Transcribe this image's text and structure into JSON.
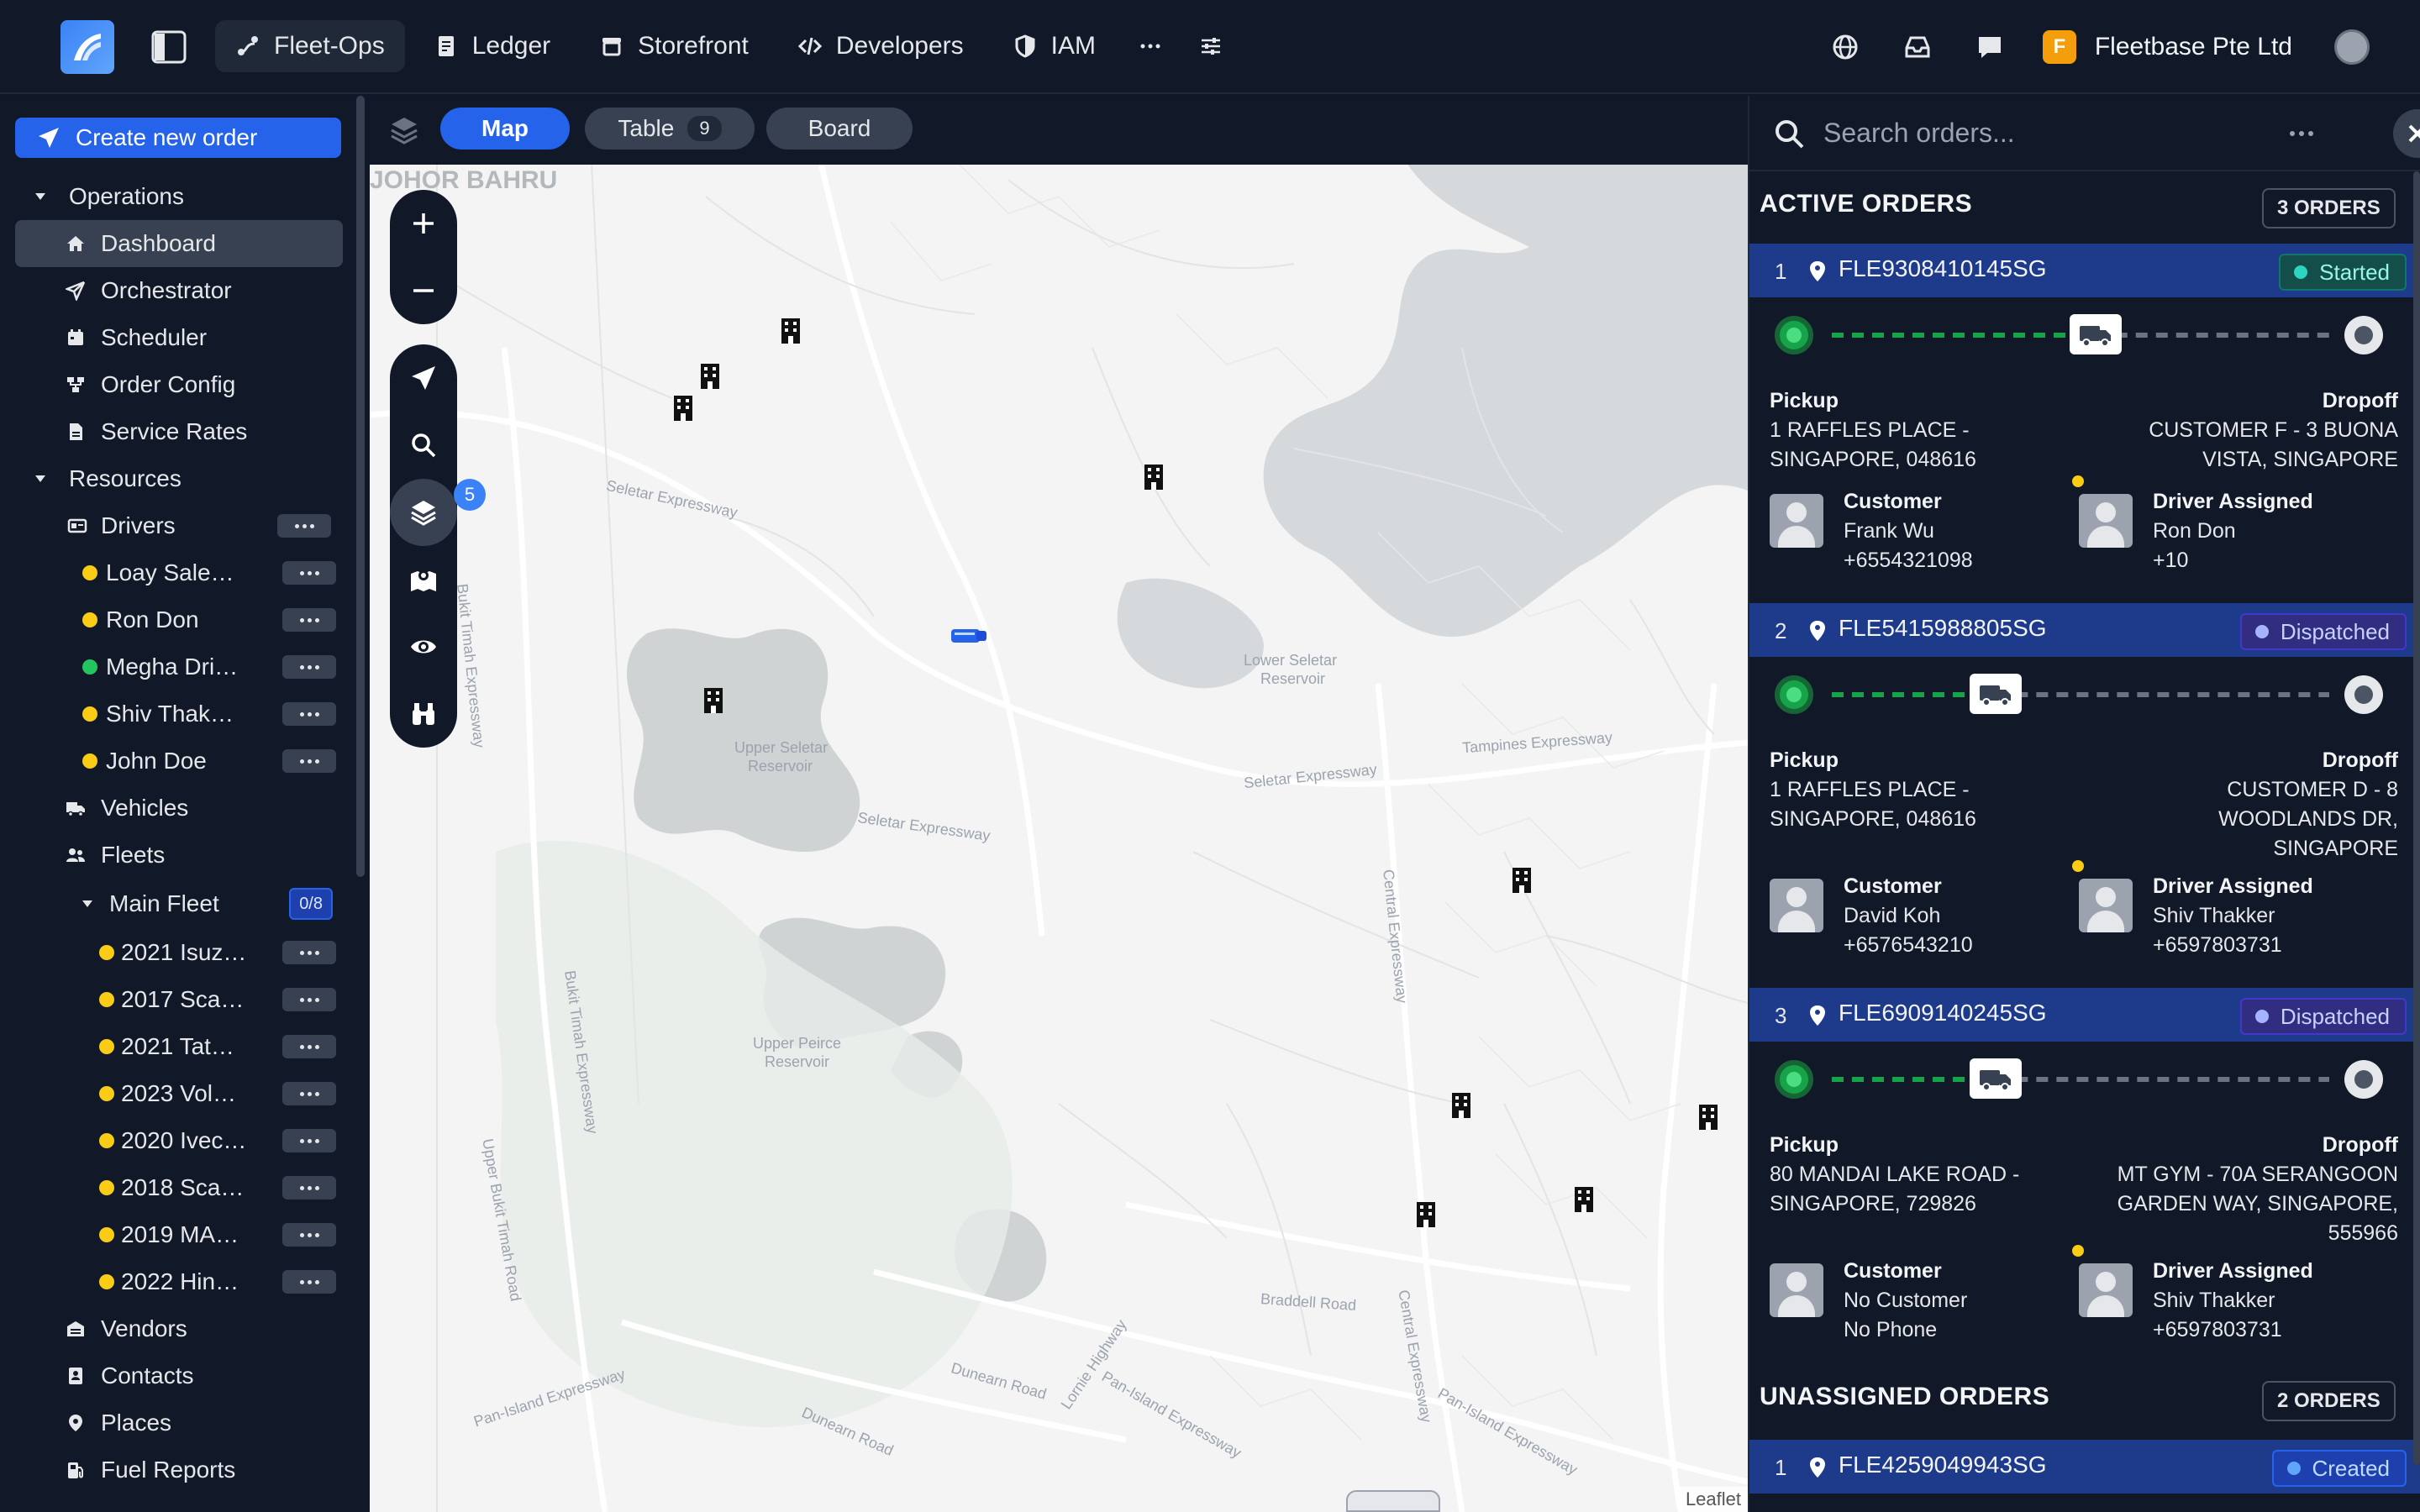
{
  "nav": {
    "items": [
      {
        "label": "Fleet-Ops",
        "icon": "route-icon"
      },
      {
        "label": "Ledger",
        "icon": "receipt-icon"
      },
      {
        "label": "Storefront",
        "icon": "store-icon"
      },
      {
        "label": "Developers",
        "icon": "code-icon"
      },
      {
        "label": "IAM",
        "icon": "shield-icon"
      }
    ],
    "org_initial": "F",
    "org_name": "Fleetbase Pte Ltd"
  },
  "sidebar": {
    "create_label": "Create new order",
    "operations": "Operations",
    "dashboard": "Dashboard",
    "orchestrator": "Orchestrator",
    "scheduler": "Scheduler",
    "order_config": "Order Config",
    "service_rates": "Service Rates",
    "resources": "Resources",
    "drivers": "Drivers",
    "driver_list": [
      {
        "name": "Loay Sale…",
        "status": "#facc15"
      },
      {
        "name": "Ron Don",
        "status": "#facc15"
      },
      {
        "name": "Megha Dri…",
        "status": "#22c55e"
      },
      {
        "name": "Shiv Thak…",
        "status": "#facc15"
      },
      {
        "name": "John Doe",
        "status": "#facc15"
      }
    ],
    "vehicles": "Vehicles",
    "fleets": "Fleets",
    "main_fleet": "Main Fleet",
    "main_fleet_count": "0/8",
    "vehicle_list": [
      {
        "name": "2021 Isuz…"
      },
      {
        "name": "2017 Sca…"
      },
      {
        "name": "2021 Tat…"
      },
      {
        "name": "2023 Vol…"
      },
      {
        "name": "2020 Ivec…"
      },
      {
        "name": "2018 Sca…"
      },
      {
        "name": "2019 MA…"
      },
      {
        "name": "2022 Hin…"
      }
    ],
    "vendors": "Vendors",
    "contacts": "Contacts",
    "places": "Places",
    "fuel_reports": "Fuel Reports"
  },
  "toolbar": {
    "map": "Map",
    "table": "Table",
    "table_count": "9",
    "board": "Board"
  },
  "map": {
    "layer_count": "5",
    "labels": {
      "johor": "JOHOR BAHRU",
      "seletar_expressway": "Seletar Expressway",
      "lower_seletar": "Lower Seletar",
      "reservoir": "Reservoir",
      "upper_seletar": "Upper Seletar",
      "tampines": "Tampines Expressway",
      "upper_peirce": "Upper Peirce",
      "bukit_timah": "Bukit Timah Expressway",
      "central_expressway": "Central Expressway",
      "braddell": "Braddell Road",
      "dunearn": "Dunearn Road",
      "pan_island": "Pan-Island Expressway",
      "lornie": "Lornie Highway",
      "upper_bukit_timah": "Upper Bukit Timah Road"
    },
    "attribution": "Leaflet"
  },
  "panel": {
    "search_placeholder": "Search orders...",
    "active_title": "ACTIVE ORDERS",
    "active_count": "3 ORDERS",
    "unassigned_title": "UNASSIGNED ORDERS",
    "unassigned_count": "2 ORDERS",
    "pickup_label": "Pickup",
    "dropoff_label": "Dropoff",
    "customer_label": "Customer",
    "driver_label": "Driver Assigned",
    "orders": [
      {
        "num": "1",
        "id": "FLE9308410145SG",
        "status": "Started",
        "progress": 0.53,
        "pickup1": "1 RAFFLES PLACE -",
        "pickup2": "SINGAPORE, 048616",
        "drop1": "CUSTOMER F - 3 BUONA",
        "drop2": "VISTA, SINGAPORE",
        "drop3": "",
        "customer_name": "Frank Wu",
        "customer_phone": "+6554321098",
        "driver_name": "Ron Don",
        "driver_phone": "+10"
      },
      {
        "num": "2",
        "id": "FLE5415988805SG",
        "status": "Dispatched",
        "progress": 0.33,
        "pickup1": "1 RAFFLES PLACE -",
        "pickup2": "SINGAPORE, 048616",
        "drop1": "CUSTOMER D - 8",
        "drop2": "WOODLANDS DR,",
        "drop3": "SINGAPORE",
        "customer_name": "David Koh",
        "customer_phone": "+6576543210",
        "driver_name": "Shiv Thakker",
        "driver_phone": "+6597803731"
      },
      {
        "num": "3",
        "id": "FLE6909140245SG",
        "status": "Dispatched",
        "progress": 0.33,
        "pickup1": "80 MANDAI LAKE ROAD -",
        "pickup2": "SINGAPORE, 729826",
        "drop1": "MT GYM - 70A SERANGOON",
        "drop2": "GARDEN WAY, SINGAPORE,",
        "drop3": "555966",
        "customer_name": "No Customer",
        "customer_phone": "No Phone",
        "driver_name": "Shiv Thakker",
        "driver_phone": "+6597803731"
      }
    ],
    "unassigned": [
      {
        "num": "1",
        "id": "FLE4259049943SG",
        "status": "Created"
      }
    ]
  }
}
